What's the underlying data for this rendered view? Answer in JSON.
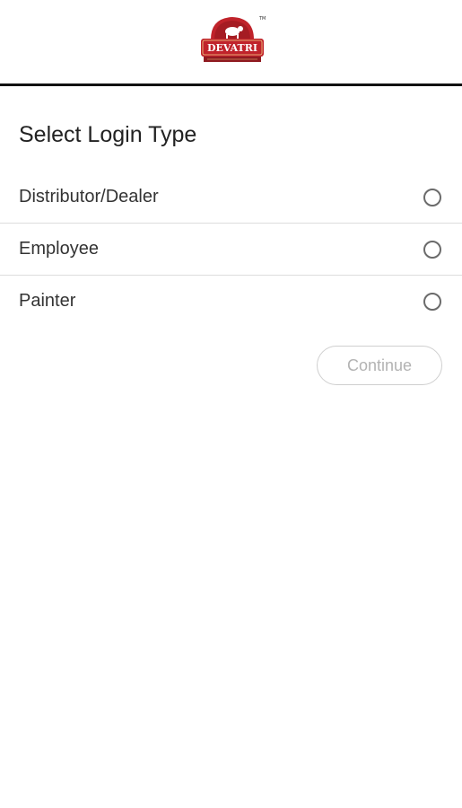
{
  "header": {
    "logo": {
      "text": "DEVATRI",
      "trademark": "TM",
      "brand_color": "#c0232b",
      "icon": "devatri-logo-icon"
    }
  },
  "main": {
    "title": "Select Login Type",
    "options": [
      {
        "label": "Distributor/Dealer",
        "selected": false
      },
      {
        "label": "Employee",
        "selected": false
      },
      {
        "label": "Painter",
        "selected": false
      }
    ],
    "continue_label": "Continue",
    "continue_enabled": false
  },
  "colors": {
    "header_border": "#111111",
    "divider": "#dddddd",
    "radio_border": "#6b6b6b",
    "button_disabled_text": "#b3b3b3"
  }
}
